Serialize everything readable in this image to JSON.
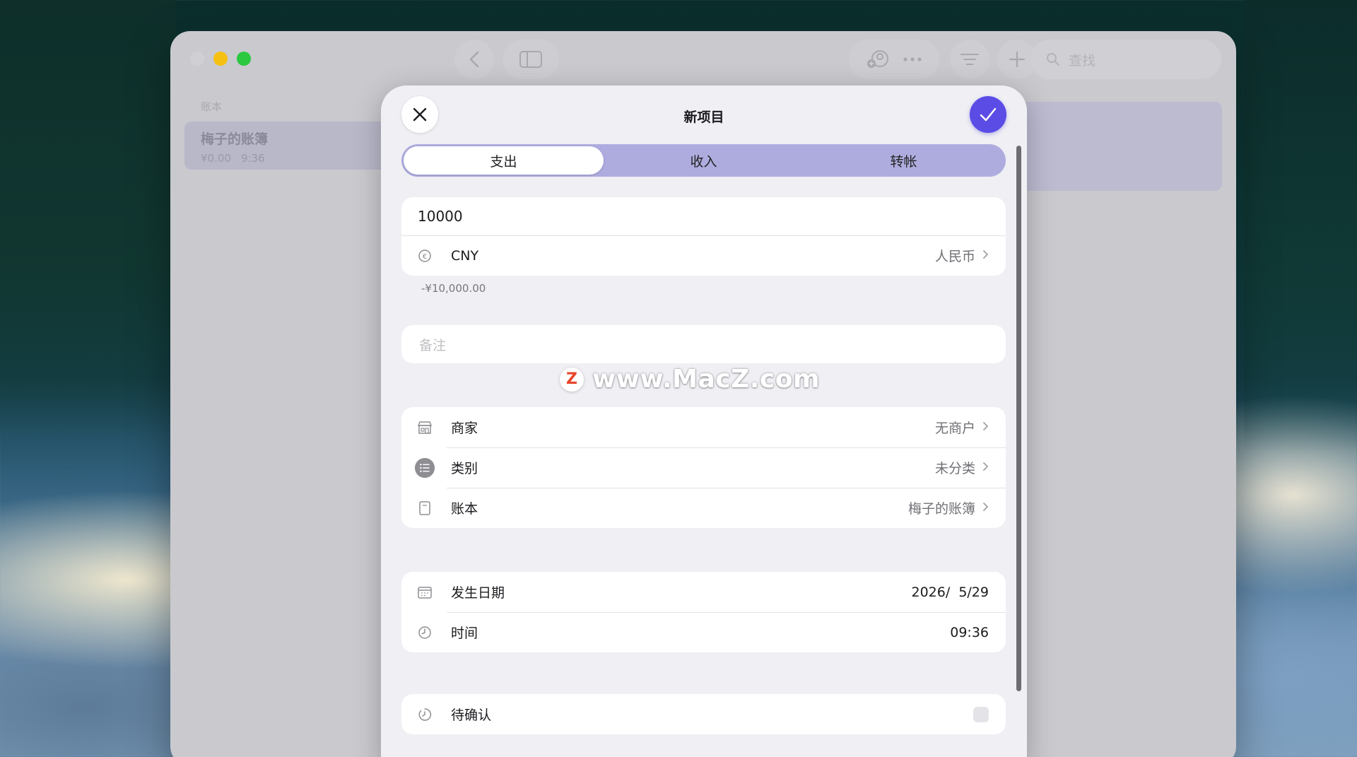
{
  "window": {
    "sidebar": {
      "header": "账本",
      "items": [
        {
          "title": "梅子的账簿",
          "amount": "¥0.00",
          "time": "9:36"
        }
      ]
    },
    "toolbar": {
      "search_placeholder": "查找"
    }
  },
  "sheet": {
    "title": "新项目",
    "tabs": [
      "支出",
      "收入",
      "转帐"
    ],
    "active_tab": "支出",
    "amount": "10000",
    "currency": {
      "code": "CNY",
      "name": "人民币"
    },
    "converted": "-¥10,000.00",
    "note_placeholder": "备注",
    "details": [
      {
        "label": "商家",
        "value": "无商户",
        "icon": "store-icon"
      },
      {
        "label": "类别",
        "value": "未分类",
        "icon": "list-icon"
      },
      {
        "label": "账本",
        "value": "梅子的账簿",
        "icon": "book-icon"
      }
    ],
    "datetime": [
      {
        "label": "发生日期",
        "value": "2026/  5/29",
        "icon": "calendar-icon"
      },
      {
        "label": "时间",
        "value": "09:36",
        "icon": "clock-icon"
      }
    ],
    "pending": {
      "label": "待确认",
      "checked": false
    }
  },
  "watermark": {
    "badge": "Z",
    "text": "www.MacZ.com"
  },
  "colors": {
    "accent": "#5b4ce6",
    "segment_bg": "#aeacdf",
    "sheet_bg": "#efeff4",
    "traffic_min": "#f6c012",
    "traffic_max": "#2bc840"
  }
}
